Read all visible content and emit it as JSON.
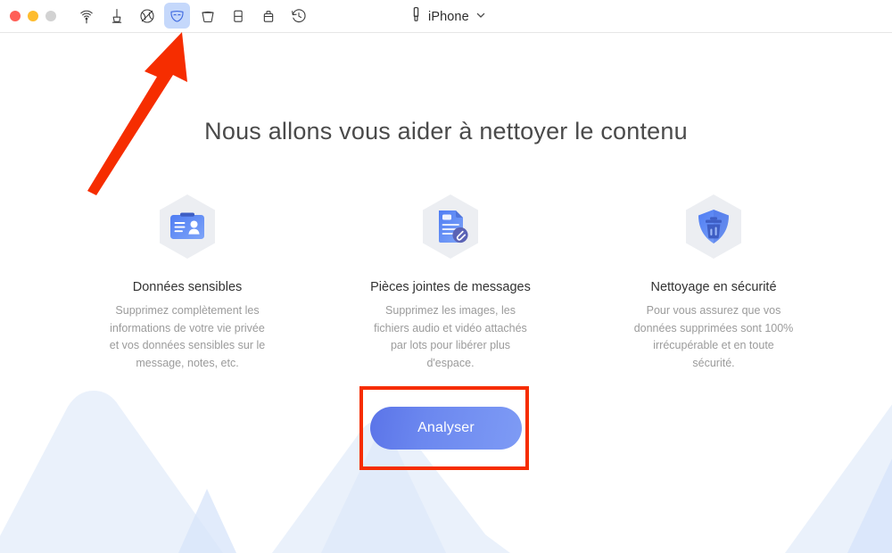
{
  "window": {
    "traffic_lights": [
      {
        "name": "close",
        "color": "#ff5f57"
      },
      {
        "name": "minimize",
        "color": "#febc2e"
      },
      {
        "name": "zoom",
        "color": "#d2d2d2"
      }
    ],
    "toolbar_icons": [
      {
        "name": "airdrop-icon",
        "active": false
      },
      {
        "name": "plunger-icon",
        "active": false
      },
      {
        "name": "globe-slash-icon",
        "active": false
      },
      {
        "name": "mask-icon",
        "active": true
      },
      {
        "name": "bucket-icon",
        "active": false
      },
      {
        "name": "eraser-icon",
        "active": false
      },
      {
        "name": "briefcase-icon",
        "active": false
      },
      {
        "name": "clock-history-icon",
        "active": false
      }
    ],
    "device": {
      "icon": "lightning-connector-icon",
      "label": "iPhone",
      "chevron": "chevron-down-icon"
    }
  },
  "main": {
    "title": "Nous allons vous aider à nettoyer le contenu",
    "features": [
      {
        "icon": "id-card-icon",
        "title": "Données sensibles",
        "description": "Supprimez complètement les informations de votre vie privée et vos données sensibles sur le message, notes, etc."
      },
      {
        "icon": "document-attachment-icon",
        "title": "Pièces jointes de messages",
        "description": "Supprimez les images, les fichiers audio et vidéo attachés par lots pour libérer plus d'espace."
      },
      {
        "icon": "shield-trash-icon",
        "title": "Nettoyage en sécurité",
        "description": "Pour vous assurez que vos données supprimées sont 100% irrécupérable et en toute sécurité."
      }
    ],
    "cta_label": "Analyser"
  },
  "annotations": {
    "color": "#f62d00",
    "box_target": "analyse-button",
    "arrow_target": "mask-icon"
  },
  "colors": {
    "accent_blue": "#6b87ef",
    "icon_blue": "#4f7df3",
    "hex_bg": "#eceef2",
    "title_text": "#4a4a4a",
    "body_text": "#9b9b9b",
    "mountain_light": "#eaf1fb",
    "mountain_dark": "#d8e5fa"
  }
}
